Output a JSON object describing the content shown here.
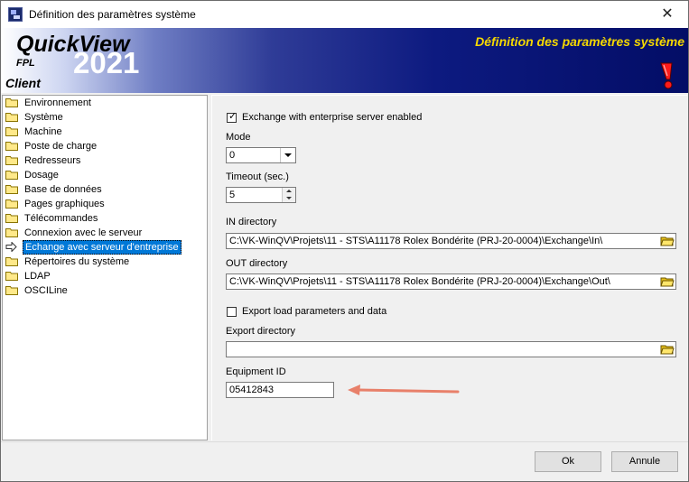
{
  "window": {
    "title": "Définition des paramètres système",
    "close_glyph": "✕"
  },
  "banner": {
    "logo_name": "QuickView",
    "logo_sub": "FPL",
    "logo_year": "2021",
    "logo_edition": "Client",
    "title": "Définition des paramètres système",
    "title_color": "#f5d800",
    "alert_icon": "exclamation-icon"
  },
  "tree": {
    "items": [
      {
        "label": "Environnement"
      },
      {
        "label": "Système"
      },
      {
        "label": "Machine"
      },
      {
        "label": "Poste de charge"
      },
      {
        "label": "Redresseurs"
      },
      {
        "label": "Dosage"
      },
      {
        "label": "Base de données"
      },
      {
        "label": "Pages graphiques"
      },
      {
        "label": "Télécommandes"
      },
      {
        "label": "Connexion avec le serveur"
      },
      {
        "label": "Echange avec serveur d'entreprise",
        "selected": true
      },
      {
        "label": "Répertoires du système"
      },
      {
        "label": "LDAP"
      },
      {
        "label": "OSCILine"
      }
    ],
    "selected_color": "#0078d7"
  },
  "panel": {
    "exchange_enabled_label": "Exchange with enterprise server enabled",
    "exchange_enabled": true,
    "mode_label": "Mode",
    "mode_value": "0",
    "timeout_label": "Timeout (sec.)",
    "timeout_value": "5",
    "in_dir_label": "IN directory",
    "in_dir_value": "C:\\VK-WinQV\\Projets\\11 - STS\\A11178 Rolex Bondérite (PRJ-20-0004)\\Exchange\\In\\",
    "out_dir_label": "OUT directory",
    "out_dir_value": "C:\\VK-WinQV\\Projets\\11 - STS\\A11178 Rolex Bondérite (PRJ-20-0004)\\Exchange\\Out\\",
    "export_label": "Export load parameters and data",
    "export_enabled": false,
    "export_dir_label": "Export directory",
    "export_dir_value": "",
    "equipment_label": "Equipment ID",
    "equipment_value": "05412843",
    "annotation_color": "#e8806a"
  },
  "footer": {
    "ok_label": "Ok",
    "cancel_label": "Annule"
  }
}
